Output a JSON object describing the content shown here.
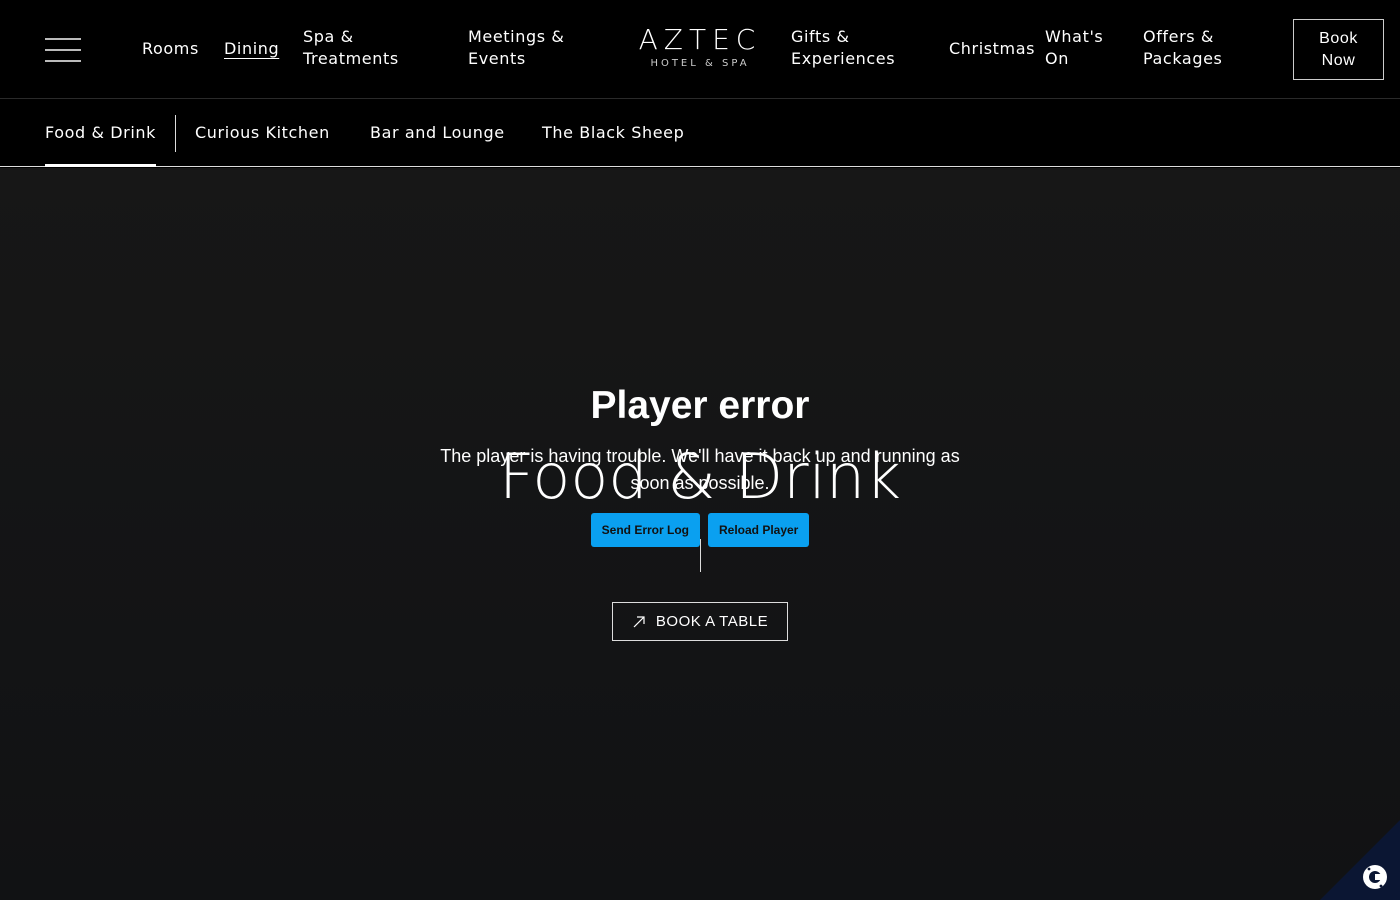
{
  "nav": {
    "items": [
      {
        "label": "Rooms"
      },
      {
        "label": "Dining"
      },
      {
        "label": "Spa &\nTreatments"
      },
      {
        "label": "Meetings &\nEvents"
      },
      {
        "label": "Gifts &\nExperiences"
      },
      {
        "label": "Christmas"
      },
      {
        "label": "What's\nOn"
      },
      {
        "label": "Offers &\nPackages"
      }
    ],
    "book_now": "Book\nNow",
    "active": "Dining"
  },
  "logo": {
    "main": "AZTEC",
    "sub": "HOTEL & SPA"
  },
  "subnav": {
    "items": [
      {
        "label": "Food & Drink"
      },
      {
        "label": "Curious Kitchen"
      },
      {
        "label": "Bar and Lounge"
      },
      {
        "label": "The Black Sheep"
      }
    ],
    "active": "Food & Drink"
  },
  "hero": {
    "title": "Food & Drink",
    "book_table": "BOOK A TABLE"
  },
  "player_error": {
    "title": "Player error",
    "message": "The player is having trouble. We'll have it back up and running as soon as possible.",
    "send_log": "Send Error Log",
    "reload": "Reload Player"
  },
  "colors": {
    "accent_button": "#0aa0f0",
    "cookie_badge": "#0b1633"
  }
}
